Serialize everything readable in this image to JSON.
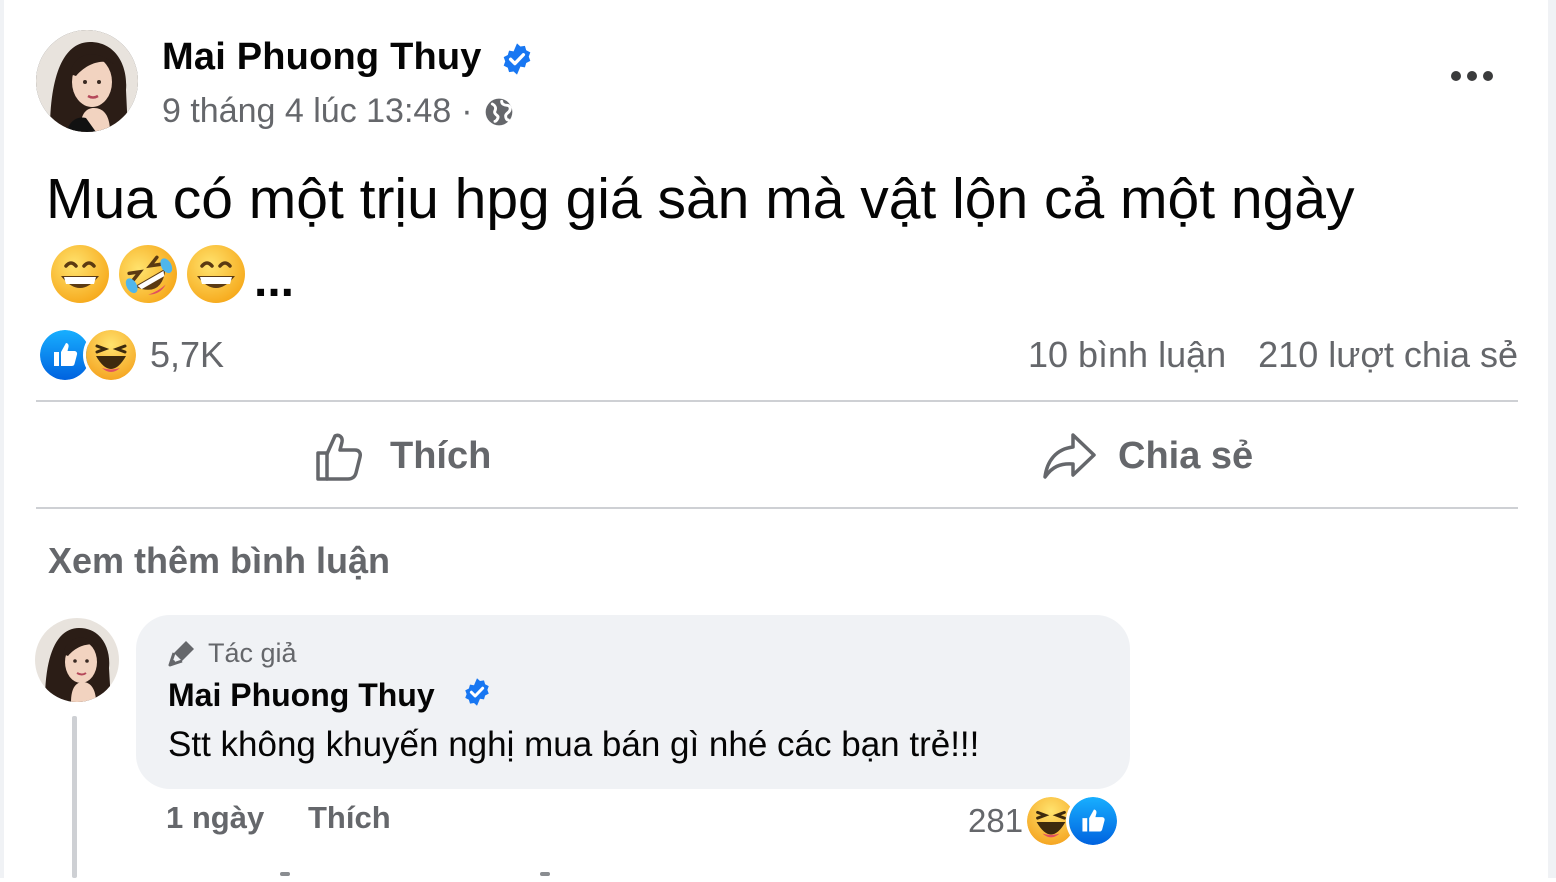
{
  "post": {
    "author": "Mai Phuong Thuy",
    "timestamp": "9 tháng 4 lúc 13:48",
    "separator": "·",
    "text": "Mua có một trịu hpg giá sàn mà vật lộn cả một ngày",
    "emojis": [
      "grinning-face",
      "rolling-on-floor-laughing",
      "grinning-face"
    ],
    "ellipsis": "...",
    "reactions": [
      "like",
      "haha"
    ],
    "reaction_count": "5,7K",
    "comment_count": "10 bình luận",
    "share_count": "210 lượt chia sẻ"
  },
  "actions": {
    "like_label": "Thích",
    "share_label": "Chia sẻ"
  },
  "comments": {
    "see_more": "Xem thêm bình luận",
    "items": [
      {
        "badge": "Tác giả",
        "author": "Mai Phuong Thuy",
        "text": "Stt không khuyến nghị mua bán gì nhé các bạn trẻ!!!",
        "time": "1 ngày",
        "like_label": "Thích",
        "reaction_count": "281",
        "reactions": [
          "haha",
          "like"
        ]
      }
    ]
  },
  "colors": {
    "text_primary": "#050505",
    "text_secondary": "#65676b",
    "accent_blue": "#1877f2",
    "bubble_bg": "#f0f2f5",
    "divider": "#ced0d4"
  }
}
